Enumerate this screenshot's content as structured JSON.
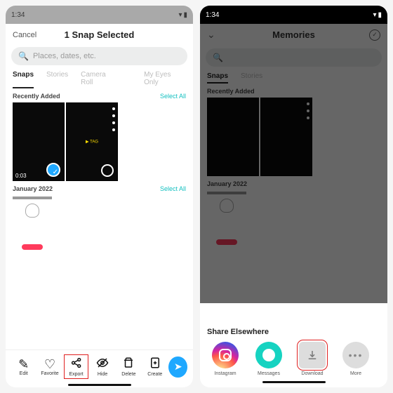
{
  "left": {
    "status": {
      "time": "1:34"
    },
    "header": {
      "cancel": "Cancel",
      "title": "1 Snap Selected"
    },
    "search": {
      "placeholder": "Places, dates, etc."
    },
    "tabs": [
      "Snaps",
      "Stories",
      "Camera Roll",
      "My Eyes Only"
    ],
    "sections": {
      "recent": {
        "label": "Recently Added",
        "select_all": "Select All"
      },
      "january": {
        "label": "January 2022",
        "select_all": "Select All"
      }
    },
    "thumbs": {
      "first_duration": "0:03",
      "second_center": "▶ TAG"
    },
    "actions": {
      "edit": "Edit",
      "favorite": "Favorite",
      "export": "Export",
      "hide": "Hide",
      "delete": "Delete",
      "create": "Create"
    }
  },
  "right": {
    "status": {
      "time": "1:34"
    },
    "memories": {
      "title": "Memories"
    },
    "sheet": {
      "title": "Share Elsewhere",
      "items": {
        "instagram": "Instagram",
        "messages": "Messages",
        "download": "Download",
        "more": "More"
      }
    }
  }
}
